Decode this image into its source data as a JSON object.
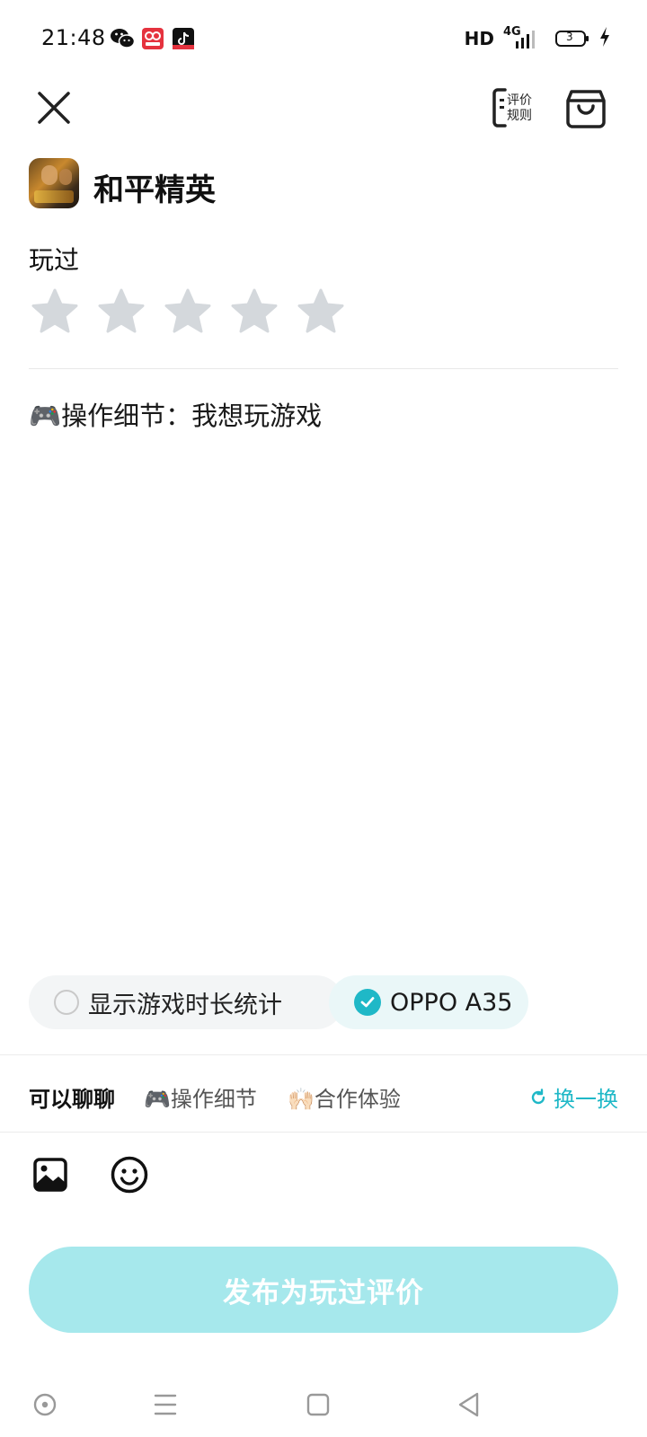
{
  "status_bar": {
    "time": "21:48",
    "network": "HD",
    "signal_label": "4G",
    "battery": "3",
    "notification_icons": [
      "wechat-icon",
      "app-icon-red",
      "tiktok-icon"
    ]
  },
  "nav": {
    "close_icon": "close-icon",
    "rules_label": "评价规则",
    "bag_icon": "shopping-bag-icon"
  },
  "game": {
    "title": "和平精英"
  },
  "rating": {
    "label": "玩过",
    "stars_total": 5,
    "stars_selected": 0
  },
  "review": {
    "text": "🎮操作细节：我想玩游戏"
  },
  "chips": {
    "playtime_label": "显示游戏时长统计",
    "playtime_checked": false,
    "device_label": "OPPO A35",
    "device_checked": true
  },
  "suggestions": {
    "label": "可以聊聊",
    "items": [
      "🎮操作细节",
      "🙌🏻合作体验"
    ],
    "refresh_label": "换一换"
  },
  "toolbar": {
    "image_icon": "image-icon",
    "emoji_icon": "emoji-icon"
  },
  "publish": {
    "label": "发布为玩过评价"
  },
  "system_nav": {
    "icons": [
      "home-circle-icon",
      "menu-icon",
      "square-icon",
      "back-icon"
    ]
  },
  "colors": {
    "accent": "#1fb8c7",
    "publish_bg": "#a6e8ec",
    "star_inactive": "#d4d8dc"
  }
}
